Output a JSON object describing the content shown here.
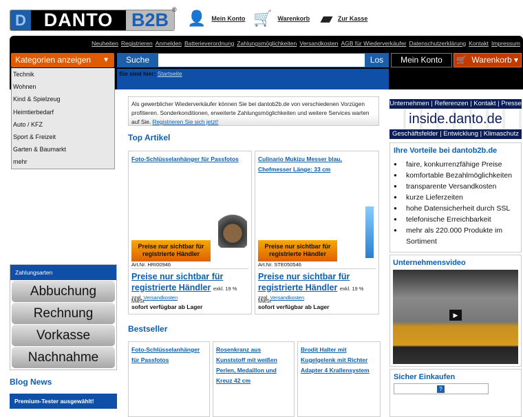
{
  "header": {
    "logo": {
      "d": "D",
      "danto": "DANTO",
      "b2b": "B2B",
      "reg": "®"
    },
    "links": [
      {
        "label": "Mein Konto",
        "icon": "person-icon"
      },
      {
        "label": "Warenkorb",
        "icon": "cart-icon"
      },
      {
        "label": "Zur Kasse",
        "icon": "cash-register-icon"
      }
    ]
  },
  "topnav": [
    "Neuheiten",
    "Registrieren",
    "Anmelden",
    "Batterieverordnung",
    "Zahlungsmöglichkeiten",
    "Versandkosten",
    "AGB für Wiederverkäufer",
    "Datenschutzerklärung",
    "Kontakt",
    "Impressum"
  ],
  "categories": {
    "button": "Kategorien anzeigen",
    "arrow": "▼",
    "items": [
      "Technik",
      "Wohnen",
      "Kind & Spielzeug",
      "Heimtierbedarf",
      "Auto / KFZ",
      "Sport & Freizeit",
      "Garten & Baumarkt",
      "mehr"
    ]
  },
  "search": {
    "label": "Suche",
    "value": "",
    "button": "Los"
  },
  "account": {
    "konto": "Mein Konto",
    "warenkorb": "Warenkorb ▾"
  },
  "breadcrumb": {
    "prefix": "Sie sind hier:",
    "link": "Startseite"
  },
  "info": {
    "text": "Als gewerblicher Wiederverkäufer können Sie bei dantob2b.de von verschiedenen Vorzügen profitieren. Sonderkonditionen, erweiterte Zahlungsmöglichkeiten und weitere Services warten auf Sie.",
    "link": "Registrieren Sie sich jetzt!"
  },
  "top": {
    "title": "Top Artikel",
    "products": [
      {
        "title": "Foto-Schlüsselanhänger für Passfotos",
        "badge": "Preise nur sichtbar für registrierte Händler",
        "art": "Art.Nr. HRI00946",
        "price": "Preise nur sichtbar für registrierte Händler",
        "tax": "exkl. 19 % MwSt",
        "zzgl": "zzgl.",
        "ship": "Versandkosten",
        "stock": "sofort verfügbar ab Lager"
      },
      {
        "title": "Culinario Mukizu Messer blau, Chefmesser Länge: 33 cm",
        "badge": "Preise nur sichtbar für registrierte Händler",
        "art": "Art.Nr. STE050546",
        "price": "Preise nur sichtbar für registrierte Händler",
        "tax": "exkl. 19 % MwSt",
        "zzgl": "zzgl.",
        "ship": "Versandkosten",
        "stock": "sofort verfügbar ab Lager"
      }
    ]
  },
  "bestseller": {
    "title": "Bestseller",
    "products": [
      "Foto-Schlüsselanhänger für Passfotos",
      "Rosenkranz aus Kunststoff mit weißen Perlen, Medaillon und Kreuz 42 cm",
      "Brodit Halter mit Kugelgelenk mit Richter Adapter 4 Krallensystem"
    ]
  },
  "payments": {
    "title": "Zahlungsarten",
    "items": [
      "Abbuchung",
      "Rechnung",
      "Vorkasse",
      "Nachnahme"
    ]
  },
  "blog": {
    "title": "Blog News",
    "item": "Premium-Tester ausgewählt!"
  },
  "inside": {
    "nav1": "Unternehmen | Referenzen | Kontakt | Presse",
    "main": "inside.danto.de",
    "nav2": "Geschäftsfelder | Entwicklung | Klimaschutz"
  },
  "vorteile": {
    "title": "Ihre Vorteile bei dantob2b.de",
    "items": [
      "faire, konkurrenzfähige Preise",
      "komfortable Bezahlmöglichkeiten",
      "transparente Versandkosten",
      "kurze Lieferzeiten",
      "hohe Datensicherheit durch SSL",
      "telefonische Erreichbarkeit",
      "mehr als 220.000 Produkte im Sortiment"
    ]
  },
  "video": {
    "title": "Unternehmensvideo",
    "play": "▶"
  },
  "secure": {
    "title": "Sicher Einkaufen",
    "badge": "?"
  }
}
